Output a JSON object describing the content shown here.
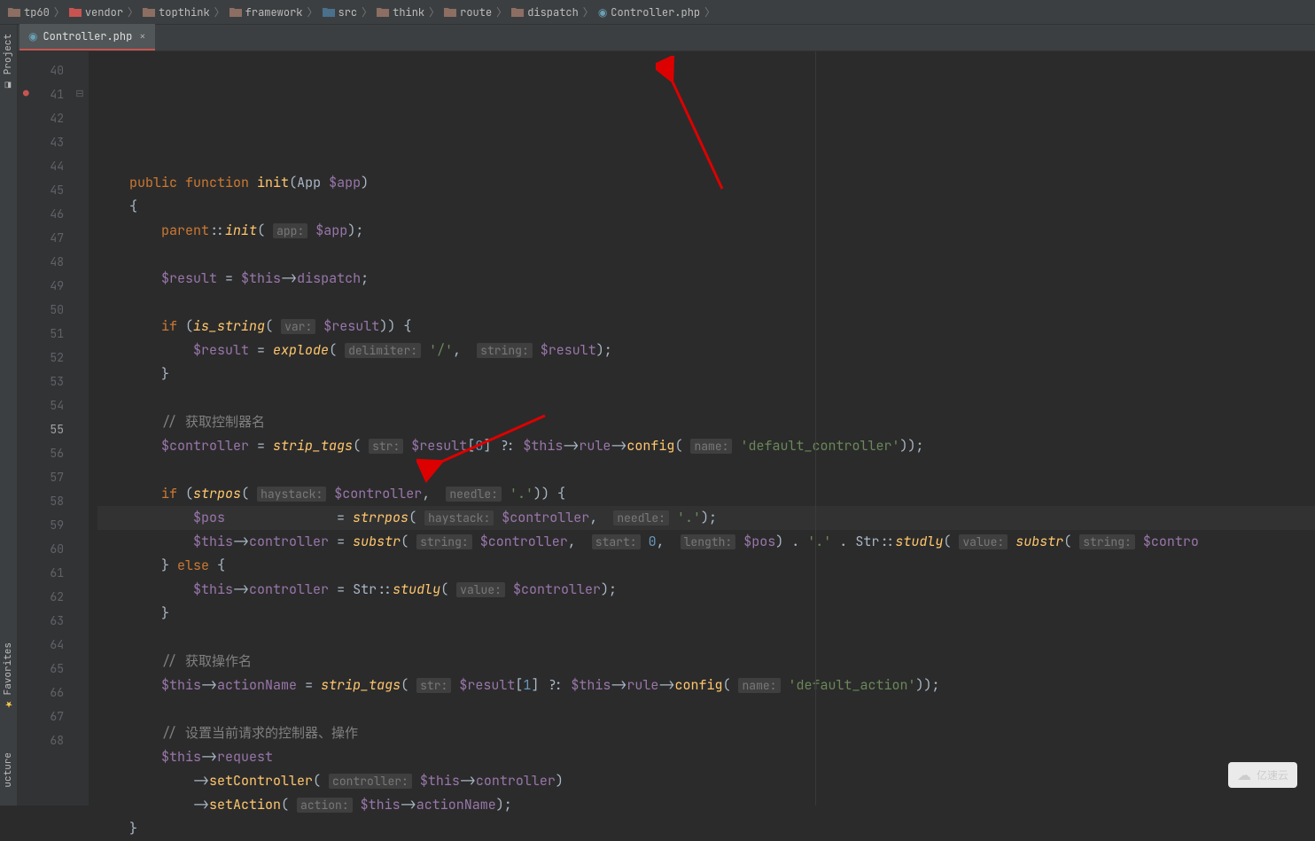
{
  "breadcrumbs": [
    {
      "label": "tp60",
      "type": "project"
    },
    {
      "label": "vendor",
      "type": "vendor"
    },
    {
      "label": "topthink",
      "type": "folder"
    },
    {
      "label": "framework",
      "type": "folder"
    },
    {
      "label": "src",
      "type": "src"
    },
    {
      "label": "think",
      "type": "folder"
    },
    {
      "label": "route",
      "type": "folder"
    },
    {
      "label": "dispatch",
      "type": "folder"
    },
    {
      "label": "Controller.php",
      "type": "php"
    }
  ],
  "tabs": [
    {
      "label": "Controller.php",
      "active": true
    }
  ],
  "gutter": {
    "start": 40,
    "end": 68,
    "current": 55
  },
  "code_lines": [
    {
      "n": 40,
      "html": ""
    },
    {
      "n": 41,
      "html": "    <span class='k'>public function</span> <span class='fn2'>init</span>(<span class='type'>App</span> <span class='var'>$app</span>)",
      "fold": "⊟",
      "icon": "●"
    },
    {
      "n": 42,
      "html": "    {"
    },
    {
      "n": 43,
      "html": "        <span class='k'>parent</span>::<span class='fn'>init</span>( <span class='hint'>app:</span> <span class='var'>$app</span>);"
    },
    {
      "n": 44,
      "html": ""
    },
    {
      "n": 45,
      "html": "        <span class='var'>$result</span> = <span class='var'>$this</span>-&gt;<span class='var'>dispatch</span>;"
    },
    {
      "n": 46,
      "html": ""
    },
    {
      "n": 47,
      "html": "        <span class='k'>if</span> (<span class='fn'>is_string</span>( <span class='hint'>var:</span> <span class='var'>$result</span>)) {"
    },
    {
      "n": 48,
      "html": "            <span class='var'>$result</span> = <span class='fn'>explode</span>( <span class='hint'>delimiter:</span> <span class='str'>'/'</span>,  <span class='hint'>string:</span> <span class='var'>$result</span>);"
    },
    {
      "n": 49,
      "html": "        }"
    },
    {
      "n": 50,
      "html": ""
    },
    {
      "n": 51,
      "html": "        <span class='cmt'>// 获取控制器名</span>"
    },
    {
      "n": 52,
      "html": "        <span class='var'>$controller</span> = <span class='fn'>strip_tags</span>( <span class='hint'>str:</span> <span class='var'>$result</span>[<span class='num'>0</span>] ?: <span class='var'>$this</span>-&gt;<span class='var'>rule</span>-&gt;<span class='fn2'>config</span>( <span class='hint'>name:</span> <span class='str'>'default_controller'</span>));"
    },
    {
      "n": 53,
      "html": ""
    },
    {
      "n": 54,
      "html": "        <span class='k'>if</span> (<span class='fn'>strpos</span>( <span class='hint'>haystack:</span> <span class='var'>$controller</span>,  <span class='hint'>needle:</span> <span class='str'>'.'</span>)) {"
    },
    {
      "n": 55,
      "html": "            <span class='var'>$pos</span>              = <span class='fn'>strrpos</span>( <span class='hint'>haystack:</span> <span class='var'>$controller</span>,  <span class='hint'>needle:</span> <span class='str'>'.'</span>);",
      "current": true
    },
    {
      "n": 56,
      "html": "            <span class='var'>$this</span>-&gt;<span class='var'>controller</span> = <span class='fn'>substr</span>( <span class='hint'>string:</span> <span class='var'>$controller</span>,  <span class='hint'>start:</span> <span class='num'>0</span>,  <span class='hint'>length:</span> <span class='var'>$pos</span>) . <span class='str'>'.'</span> . <span class='cls'>Str</span>::<span class='static'>studly</span>( <span class='hint'>value:</span> <span class='fn'>substr</span>( <span class='hint'>string:</span> <span class='var'>$contro</span>"
    },
    {
      "n": 57,
      "html": "        } <span class='k'>else</span> {"
    },
    {
      "n": 58,
      "html": "            <span class='var'>$this</span>-&gt;<span class='var'>controller</span> = <span class='cls'>Str</span>::<span class='static'>studly</span>( <span class='hint'>value:</span> <span class='var'>$controller</span>);"
    },
    {
      "n": 59,
      "html": "        }"
    },
    {
      "n": 60,
      "html": ""
    },
    {
      "n": 61,
      "html": "        <span class='cmt'>// 获取操作名</span>"
    },
    {
      "n": 62,
      "html": "        <span class='var'>$this</span>-&gt;<span class='var'>actionName</span> = <span class='fn'>strip_tags</span>( <span class='hint'>str:</span> <span class='var'>$result</span>[<span class='num'>1</span>] ?: <span class='var'>$this</span>-&gt;<span class='var'>rule</span>-&gt;<span class='fn2'>config</span>( <span class='hint'>name:</span> <span class='str'>'default_action'</span>));"
    },
    {
      "n": 63,
      "html": ""
    },
    {
      "n": 64,
      "html": "        <span class='cmt'>// 设置当前请求的控制器、操作</span>"
    },
    {
      "n": 65,
      "html": "        <span class='var'>$this</span>-&gt;<span class='var'>request</span>"
    },
    {
      "n": 66,
      "html": "            -&gt;<span class='fn2'>setController</span>( <span class='hint'>controller:</span> <span class='var'>$this</span>-&gt;<span class='var'>controller</span>)"
    },
    {
      "n": 67,
      "html": "            -&gt;<span class='fn2'>setAction</span>( <span class='hint'>action:</span> <span class='var'>$this</span>-&gt;<span class='var'>actionName</span>);"
    },
    {
      "n": 68,
      "html": "    }"
    }
  ],
  "sidebar": {
    "project": "Project",
    "favorites": "Favorites",
    "structure": "ucture"
  },
  "watermark": "亿速云"
}
